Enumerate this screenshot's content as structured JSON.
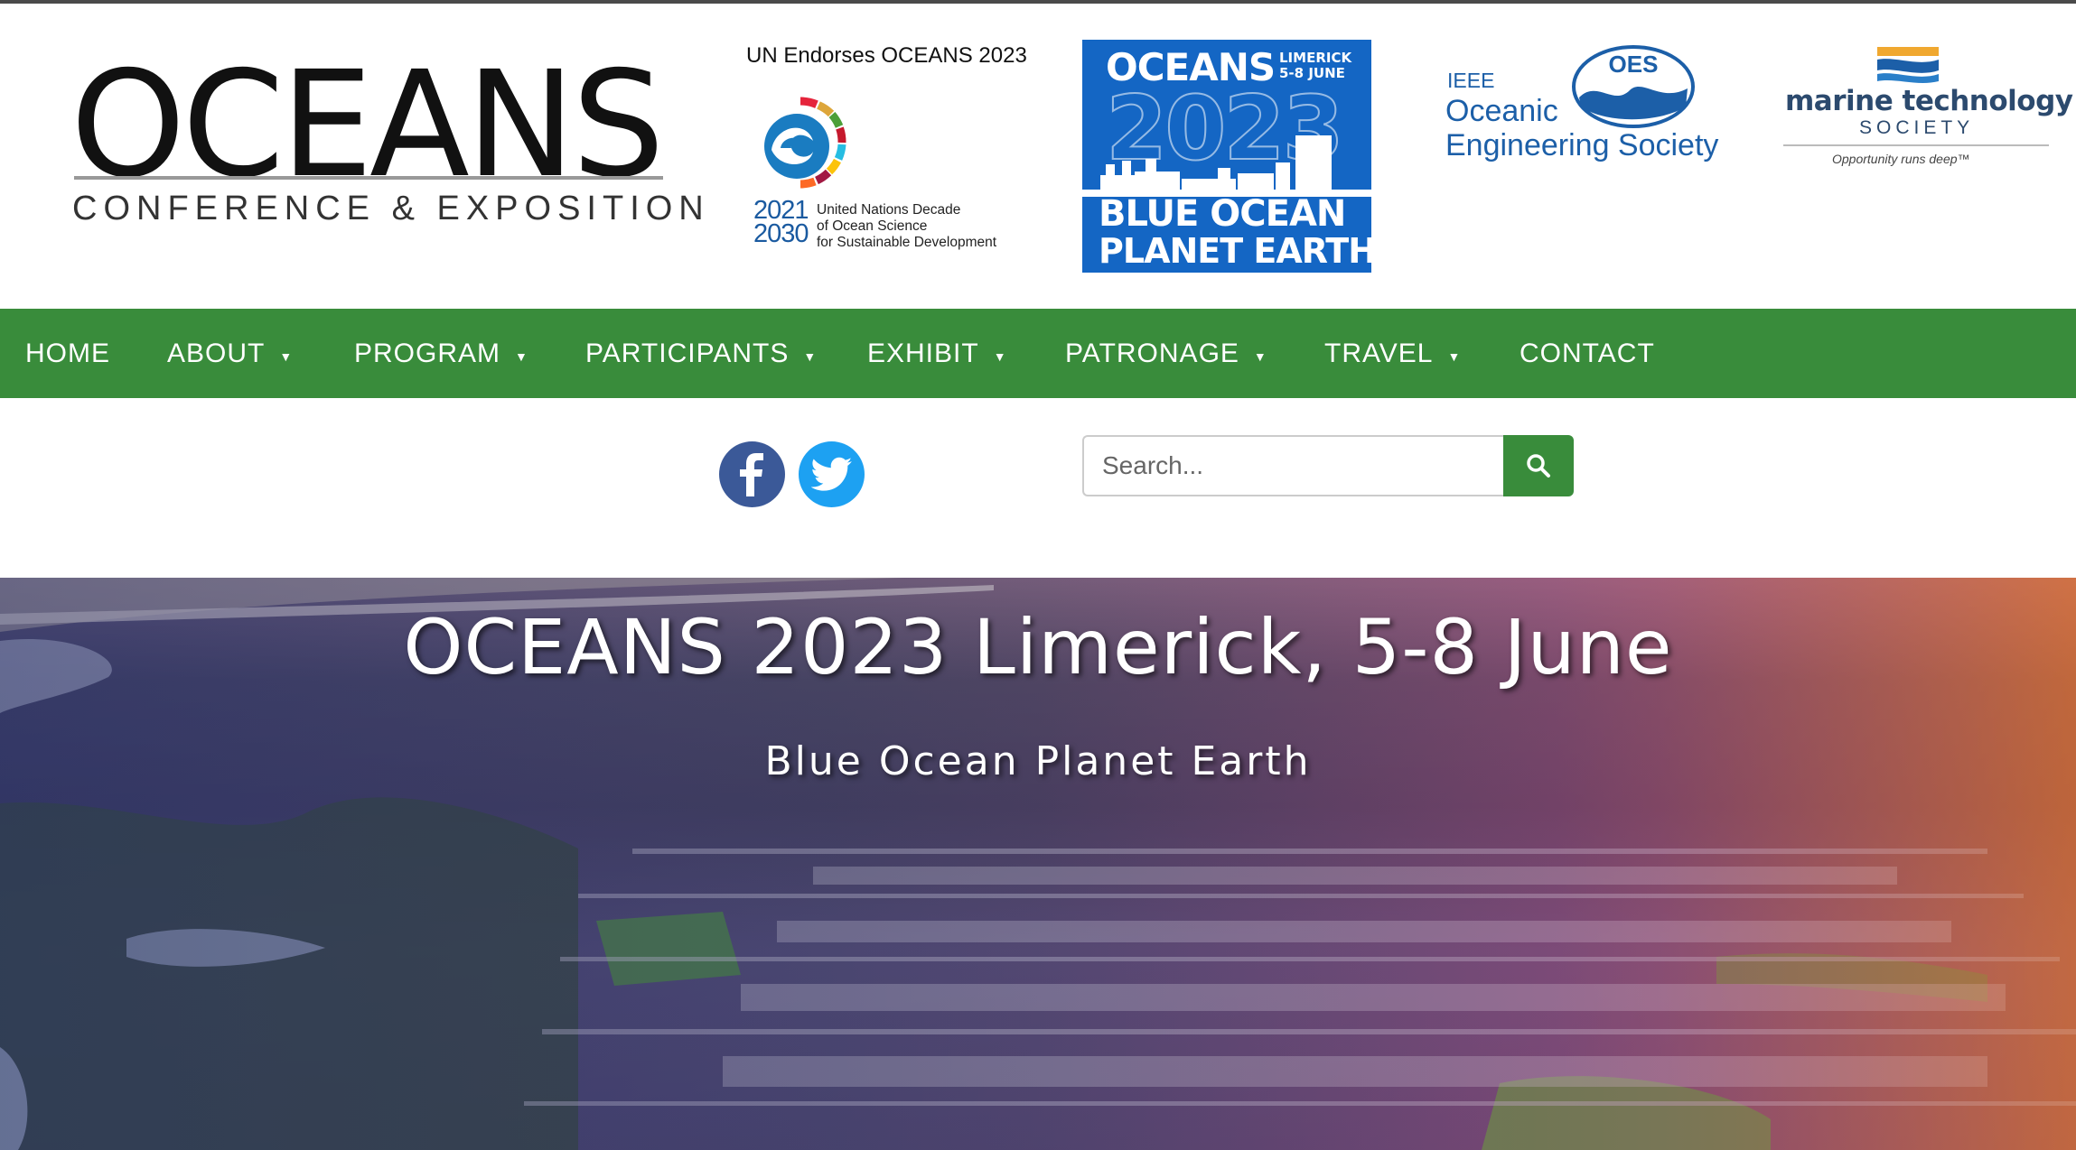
{
  "header": {
    "oceans_logo": {
      "word": "OCEANS",
      "subtitle": "CONFERENCE & EXPOSITION"
    },
    "un_endorse": {
      "title": "UN Endorses OCEANS 2023",
      "years": [
        "2021",
        "2030"
      ],
      "description": [
        "United Nations Decade",
        "of Ocean Science",
        "for Sustainable Development"
      ]
    },
    "event_badge": {
      "oceans": "OCEANS",
      "location": [
        "LIMERICK",
        "5-8 JUNE"
      ],
      "year": "2023",
      "line1": "BLUE OCEAN",
      "line2": "PLANET EARTH",
      "color": "#1466c4"
    },
    "oes_logo": {
      "ieee": "IEEE",
      "oceanic": "Oceanic",
      "engineering": "Engineering Society",
      "badge": "OES"
    },
    "mts_logo": {
      "name": "marine technology",
      "society": "SOCIETY",
      "tagline": "Opportunity runs deep™"
    }
  },
  "nav": {
    "color": "#398c3b",
    "items": [
      {
        "label": "HOME",
        "has_dropdown": false
      },
      {
        "label": "ABOUT",
        "has_dropdown": true
      },
      {
        "label": "PROGRAM",
        "has_dropdown": true
      },
      {
        "label": "PARTICIPANTS",
        "has_dropdown": true
      },
      {
        "label": "EXHIBIT",
        "has_dropdown": true
      },
      {
        "label": "PATRONAGE",
        "has_dropdown": true
      },
      {
        "label": "TRAVEL",
        "has_dropdown": true
      },
      {
        "label": "CONTACT",
        "has_dropdown": false
      }
    ],
    "caret": "▼"
  },
  "social": {
    "facebook": "facebook-icon",
    "twitter": "twitter-icon"
  },
  "search": {
    "placeholder": "Search...",
    "value": "",
    "button_icon": "search-icon"
  },
  "hero": {
    "title": "OCEANS 2023 Limerick, 5-8 June",
    "subtitle": "Blue Ocean Planet Earth"
  }
}
